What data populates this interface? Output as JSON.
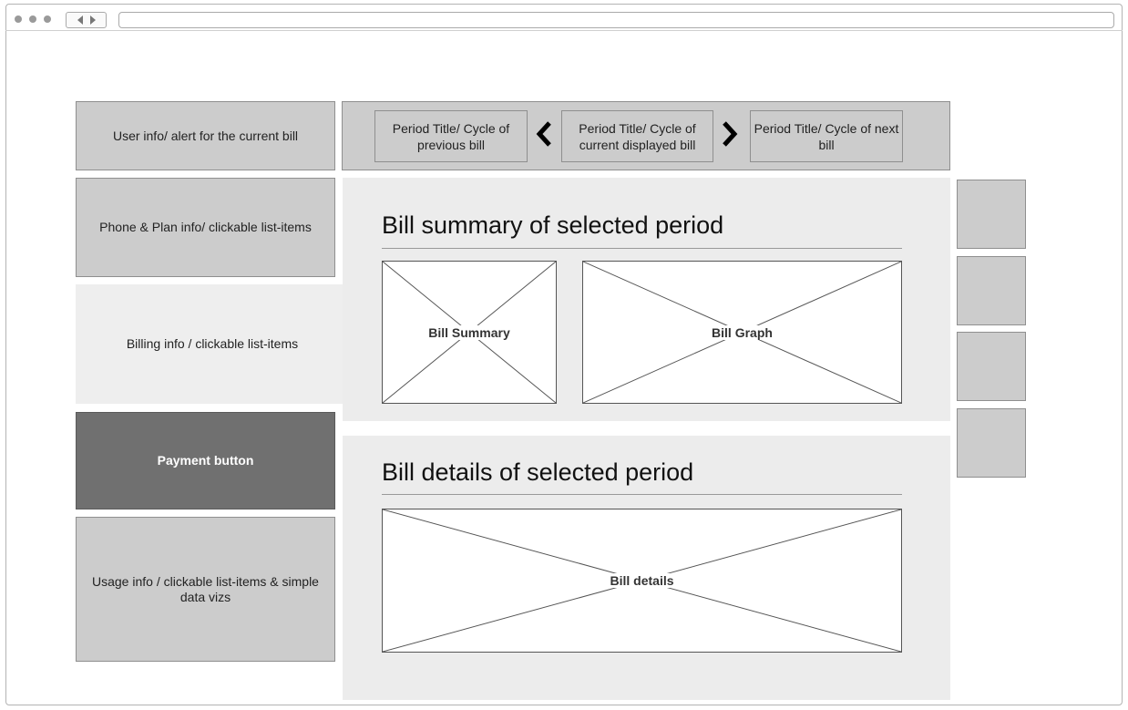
{
  "left": {
    "user_info": "User info/ alert for the current bill",
    "phone_plan": "Phone & Plan info/ clickable list-items",
    "billing_info": "Billing info / clickable list-items",
    "payment_button": "Payment button",
    "usage_info": "Usage info / clickable list-items & simple data vizs"
  },
  "period_nav": {
    "previous": "Period Title/ Cycle of previous bill",
    "current": "Period Title/ Cycle of current displayed bill",
    "next": "Period Title/ Cycle of next bill"
  },
  "summary": {
    "title": "Bill summary of selected period",
    "bill_summary_label": "Bill Summary",
    "bill_graph_label": "Bill Graph"
  },
  "details": {
    "title": "Bill details of selected period",
    "bill_details_label": "Bill details"
  },
  "icons": [
    "back-arrow-icon",
    "forward-arrow-icon",
    "chevron-left-icon",
    "chevron-right-icon"
  ]
}
